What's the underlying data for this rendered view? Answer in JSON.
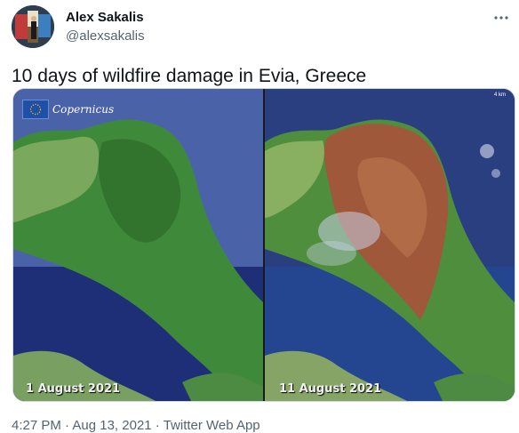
{
  "author": {
    "name": "Alex Sakalis",
    "handle": "@alexsakalis"
  },
  "tweet": {
    "text": "10 days of wildfire damage in Evia, Greece"
  },
  "media": {
    "logo_text": "Copernicus",
    "scale": "4 km",
    "left_date": "1 August 2021",
    "right_date": "11 August 2021"
  },
  "meta": {
    "time": "4:27 PM",
    "date": "Aug 13, 2021",
    "source": "Twitter Web App",
    "separator": " · "
  },
  "icons": {
    "more": "more-horizontal-icon",
    "eu_flag": "eu-flag-icon"
  },
  "colors": {
    "text_primary": "#0f1419",
    "text_secondary": "#536471",
    "sea": "#2a4b8c",
    "land_green": "#3f8a3a",
    "burn_scar": "#a0583a"
  }
}
